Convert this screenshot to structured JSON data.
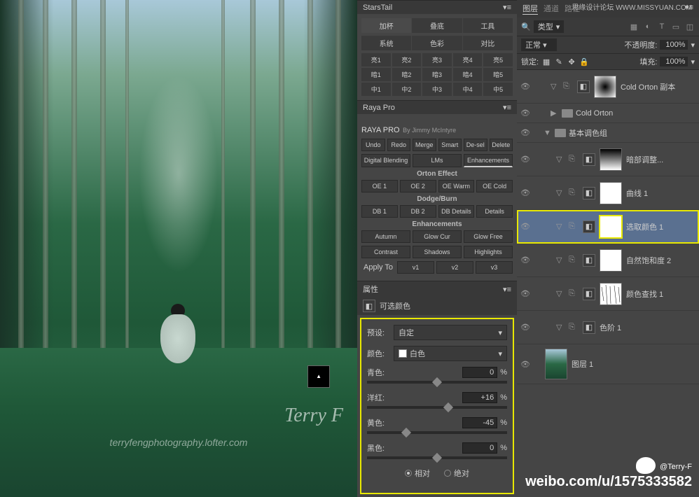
{
  "top_credit": "思缘设计论坛  WWW.MISSYUAN.COM",
  "image": {
    "watermark_name": "Terry F",
    "watermark_url": "terryfengphotography.lofter.com"
  },
  "starsTail": {
    "title": "StarsTail",
    "tabs_row1": [
      "加杯",
      "叠底",
      "工具"
    ],
    "tabs_row2": [
      "系统",
      "色彩",
      "对比"
    ],
    "grid": [
      [
        "亮1",
        "亮2",
        "亮3",
        "亮4",
        "亮5"
      ],
      [
        "暗1",
        "暗2",
        "暗3",
        "暗4",
        "暗5"
      ],
      [
        "中1",
        "中2",
        "中3",
        "中4",
        "中5"
      ]
    ]
  },
  "raya": {
    "title": "Raya Pro",
    "panel_title": "RAYA PRO",
    "by": "By Jimmy McIntyre",
    "row1": [
      "Undo",
      "Redo",
      "Merge",
      "Smart",
      "De-sel",
      "Delete"
    ],
    "row2": [
      "Digital Blending",
      "LMs",
      "Enhancements"
    ],
    "sec1": "Orton Effect",
    "row3": [
      "OE 1",
      "OE 2",
      "OE Warm",
      "OE Cold"
    ],
    "sec2": "Dodge/Burn",
    "row4": [
      "DB 1",
      "DB 2",
      "DB Details",
      "Details"
    ],
    "sec3": "Enhancements",
    "row5": [
      "Autumn",
      "Glow Cur",
      "Glow Free"
    ],
    "row6": [
      "Contrast",
      "Shadows",
      "Highlights"
    ],
    "apply": "Apply To",
    "apply_opts": [
      "v1",
      "v2",
      "v3"
    ]
  },
  "properties": {
    "title": "属性",
    "type_label": "可选颜色",
    "preset_label": "预设:",
    "preset_value": "自定",
    "color_label": "颜色:",
    "color_value": "白色",
    "sliders": [
      {
        "label": "青色:",
        "value": "0",
        "pos": 50
      },
      {
        "label": "洋红:",
        "value": "+16",
        "pos": 58
      },
      {
        "label": "黄色:",
        "value": "-45",
        "pos": 28
      },
      {
        "label": "黑色:",
        "value": "0",
        "pos": 50
      }
    ],
    "unit": "%",
    "radio1": "相对",
    "radio2": "绝对"
  },
  "layers": {
    "tabs": [
      "图层",
      "通道",
      "路径"
    ],
    "filter_label": "类型",
    "blend_mode": "正常",
    "opacity_label": "不透明度:",
    "opacity_value": "100%",
    "lock_label": "锁定:",
    "fill_label": "填充:",
    "fill_value": "100%",
    "items": [
      {
        "name": "Cold Orton 副本",
        "mask": "radial",
        "indent": 2
      },
      {
        "name": "Cold Orton",
        "group": true,
        "indent": 2
      },
      {
        "name": "基本调色组",
        "group": true,
        "open": true,
        "indent": 1
      },
      {
        "name": "暗部调整...",
        "mask": "gradient",
        "indent": 3
      },
      {
        "name": "曲线 1",
        "mask": "white",
        "indent": 3
      },
      {
        "name": "选取颜色 1",
        "mask": "white",
        "indent": 3,
        "selected": true,
        "highlight": true
      },
      {
        "name": "自然饱和度 2",
        "mask": "white",
        "indent": 3
      },
      {
        "name": "颜色查找 1",
        "mask": "noise",
        "indent": 3
      },
      {
        "name": "色阶 1",
        "mask": "figure",
        "indent": 3
      },
      {
        "name": "图层 1",
        "thumb": true,
        "indent": 1
      }
    ]
  },
  "credit": {
    "at": "@Terry-F",
    "url": "weibo.com/u/1575333582"
  }
}
